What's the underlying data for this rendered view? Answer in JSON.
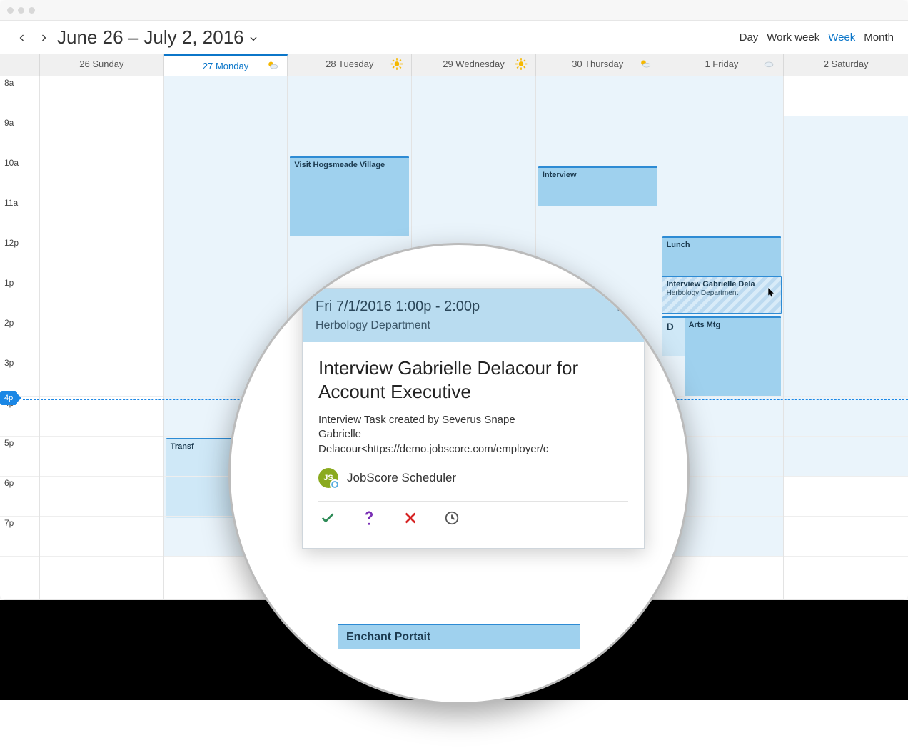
{
  "header": {
    "range": "June 26 – July 2, 2016",
    "views": [
      "Day",
      "Work week",
      "Week",
      "Month"
    ],
    "active_view": "Week"
  },
  "days": [
    {
      "label": "26 Sunday",
      "weather": null,
      "shade": "none"
    },
    {
      "label": "27 Monday",
      "weather": "partly",
      "today": true,
      "shade": "full"
    },
    {
      "label": "28 Tuesday",
      "weather": "sunny",
      "shade": "full"
    },
    {
      "label": "29 Wednesday",
      "weather": "sunny",
      "shade": "full"
    },
    {
      "label": "30 Thursday",
      "weather": "partly",
      "shade": "full"
    },
    {
      "label": "1 Friday",
      "weather": "cloudy",
      "shade": "full"
    },
    {
      "label": "2 Saturday",
      "weather": null,
      "shade": "midday"
    }
  ],
  "time_labels": [
    "8a",
    "9a",
    "10a",
    "11a",
    "12p",
    "1p",
    "2p",
    "3p",
    "4p",
    "5p",
    "6p",
    "7p"
  ],
  "now_label": "4p",
  "events": {
    "mon_transf": {
      "title": "Transf"
    },
    "tue_visit": {
      "title": "Visit Hogsmeade Village"
    },
    "thu_interview": {
      "title": "Interview"
    },
    "fri_lunch": {
      "title": "Lunch"
    },
    "fri_interview": {
      "title": "Interview Gabrielle Dela",
      "sub": "Herbology Department"
    },
    "fri_arts": {
      "title": "Arts Mtg"
    },
    "fri_d": {
      "title": "D"
    }
  },
  "popup": {
    "datetime": "Fri 7/1/2016 1:00p - 2:00p",
    "location": "Herbology Department",
    "title": "Interview Gabrielle Delacour for Account Executive",
    "desc_line1": "Interview Task created by Severus Snape",
    "desc_line2": "Gabrielle",
    "desc_line3": "Delacour<https://demo.jobscore.com/employer/c",
    "organizer_initials": "JS",
    "organizer_name": "JobScore Scheduler",
    "behind_event": "Enchant Portait"
  }
}
